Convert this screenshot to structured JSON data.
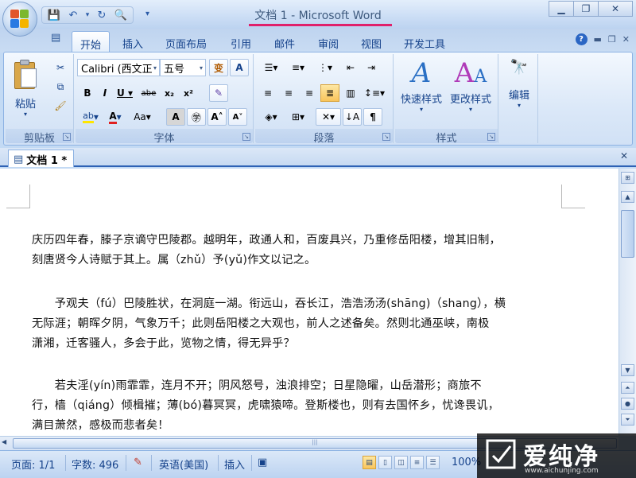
{
  "window": {
    "title": "文档 1 - Microsoft Word"
  },
  "qat": {
    "save": "💾",
    "undo": "↶",
    "redo": "↻",
    "print_preview": "🔍"
  },
  "ribbon": {
    "tabs": [
      "开始",
      "插入",
      "页面布局",
      "引用",
      "邮件",
      "审阅",
      "视图",
      "开发工具"
    ],
    "active_tab": "开始",
    "groups": {
      "clipboard": {
        "label": "剪贴板",
        "paste": "粘贴"
      },
      "font": {
        "label": "字体",
        "font_name": "Calibri (西文正",
        "font_size": "五号"
      },
      "paragraph": {
        "label": "段落"
      },
      "styles": {
        "label": "样式",
        "quick_styles": "快速样式",
        "change_styles": "更改样式"
      },
      "editing": {
        "label": "编辑"
      }
    }
  },
  "document_tab": {
    "name": "文档 1 *"
  },
  "document": {
    "paragraphs": [
      {
        "lines": [
          "庆历四年春，滕子京谪守巴陵郡。越明年，政通人和，百废具兴，乃重修岳阳楼，增其旧制，",
          "刻唐贤今人诗赋于其上。属（zhǔ）予(yǔ)作文以记之。"
        ]
      },
      {
        "lines": [
          "　　予观夫（fú）巴陵胜状，在洞庭一湖。衔远山，吞长江，浩浩汤汤(shāng)（shang），横",
          "无际涯；朝晖夕阴，气象万千；此则岳阳楼之大观也，前人之述备矣。然则北通巫峡，南极",
          "潇湘，迁客骚人，多会于此，览物之情，得无异乎？"
        ]
      },
      {
        "lines": [
          "　　若夫淫(yín)雨霏霏，连月不开；阴风怒号，浊浪排空；日星隐曜，山岳潜形；商旅不",
          "行，樯（qiáng）倾楫摧；薄(bó)暮冥冥，虎啸猿啼。登斯楼也，则有去国怀乡，忧谗畏讥，",
          "满目萧然，感极而悲者矣！"
        ]
      }
    ]
  },
  "statusbar": {
    "page": "页面: 1/1",
    "words": "字数: 496",
    "language": "英语(美国)",
    "insert_mode": "插入",
    "zoom": "100%"
  },
  "watermark": {
    "text": "爱纯净",
    "url": "www.aichunjing.com"
  },
  "colors": {
    "accent": "#2e62b5",
    "title_underline": "#e0206b",
    "ribbon_text": "#15428b"
  }
}
